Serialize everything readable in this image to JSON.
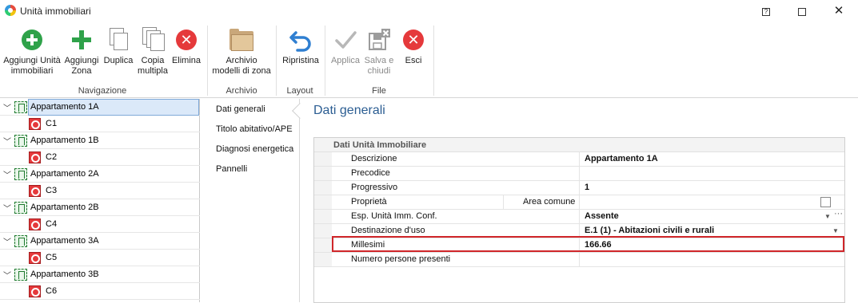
{
  "window": {
    "title": "Unità immobiliari",
    "help_label": "?",
    "close_label": "✕"
  },
  "ribbon": {
    "groups": [
      {
        "name": "Navigazione"
      },
      {
        "name": "Archivio"
      },
      {
        "name": "Layout"
      },
      {
        "name": "File"
      }
    ],
    "buttons": {
      "aggiungi_unita": {
        "line1": "Aggiungi Unità",
        "line2": "immobiliari",
        "icon": "add-circle-icon"
      },
      "aggiungi_zona": {
        "line1": "Aggiungi",
        "line2": "Zona",
        "icon": "plus-icon"
      },
      "duplica": {
        "line1": "Duplica",
        "icon": "copy-icon"
      },
      "copia_multipla": {
        "line1": "Copia",
        "line2": "multipla",
        "icon": "copy-multiple-icon"
      },
      "elimina": {
        "line1": "Elimina",
        "icon": "delete-icon"
      },
      "archivio_modelli": {
        "line1": "Archivio",
        "line2": "modelli di zona",
        "icon": "folder-icon"
      },
      "ripristina": {
        "line1": "Ripristina",
        "icon": "undo-icon"
      },
      "applica": {
        "line1": "Applica",
        "icon": "check-icon",
        "disabled": true
      },
      "salva_chiudi": {
        "line1": "Salva e",
        "line2": "chiudi",
        "icon": "save-close-icon",
        "disabled": true
      },
      "esci": {
        "line1": "Esci",
        "icon": "exit-icon"
      }
    }
  },
  "tree": {
    "items": [
      {
        "label": "Appartamento 1A",
        "child": "C1",
        "selected": true
      },
      {
        "label": "Appartamento 1B",
        "child": "C2"
      },
      {
        "label": "Appartamento 2A",
        "child": "C3"
      },
      {
        "label": "Appartamento 2B",
        "child": "C4"
      },
      {
        "label": "Appartamento 3A",
        "child": "C5"
      },
      {
        "label": "Appartamento 3B",
        "child": "C6"
      }
    ]
  },
  "sidenav": {
    "items": [
      "Dati generali",
      "Titolo abitativo/APE",
      "Diagnosi energetica",
      "Pannelli"
    ],
    "active": "Dati generali"
  },
  "content": {
    "title": "Dati generali",
    "section": "Dati Unità Immobiliare",
    "rows": [
      {
        "label": "Descrizione",
        "value": "Appartamento 1A"
      },
      {
        "label": "Precodice",
        "value": ""
      },
      {
        "label": "Progressivo",
        "value": "1"
      },
      {
        "label": "Proprietà",
        "sublabel": "Area comune",
        "value": "",
        "checkbox": false
      },
      {
        "label": "Esp. Unità Imm. Conf.",
        "value": "Assente"
      },
      {
        "label": "Destinazione d'uso",
        "value": "E.1 (1) - Abitazioni civili e rurali"
      },
      {
        "label": "Millesimi",
        "value": "166.66",
        "highlighted": true
      },
      {
        "label": "Numero persone presenti",
        "value": ""
      }
    ],
    "highlight_color": "#d0262a"
  }
}
